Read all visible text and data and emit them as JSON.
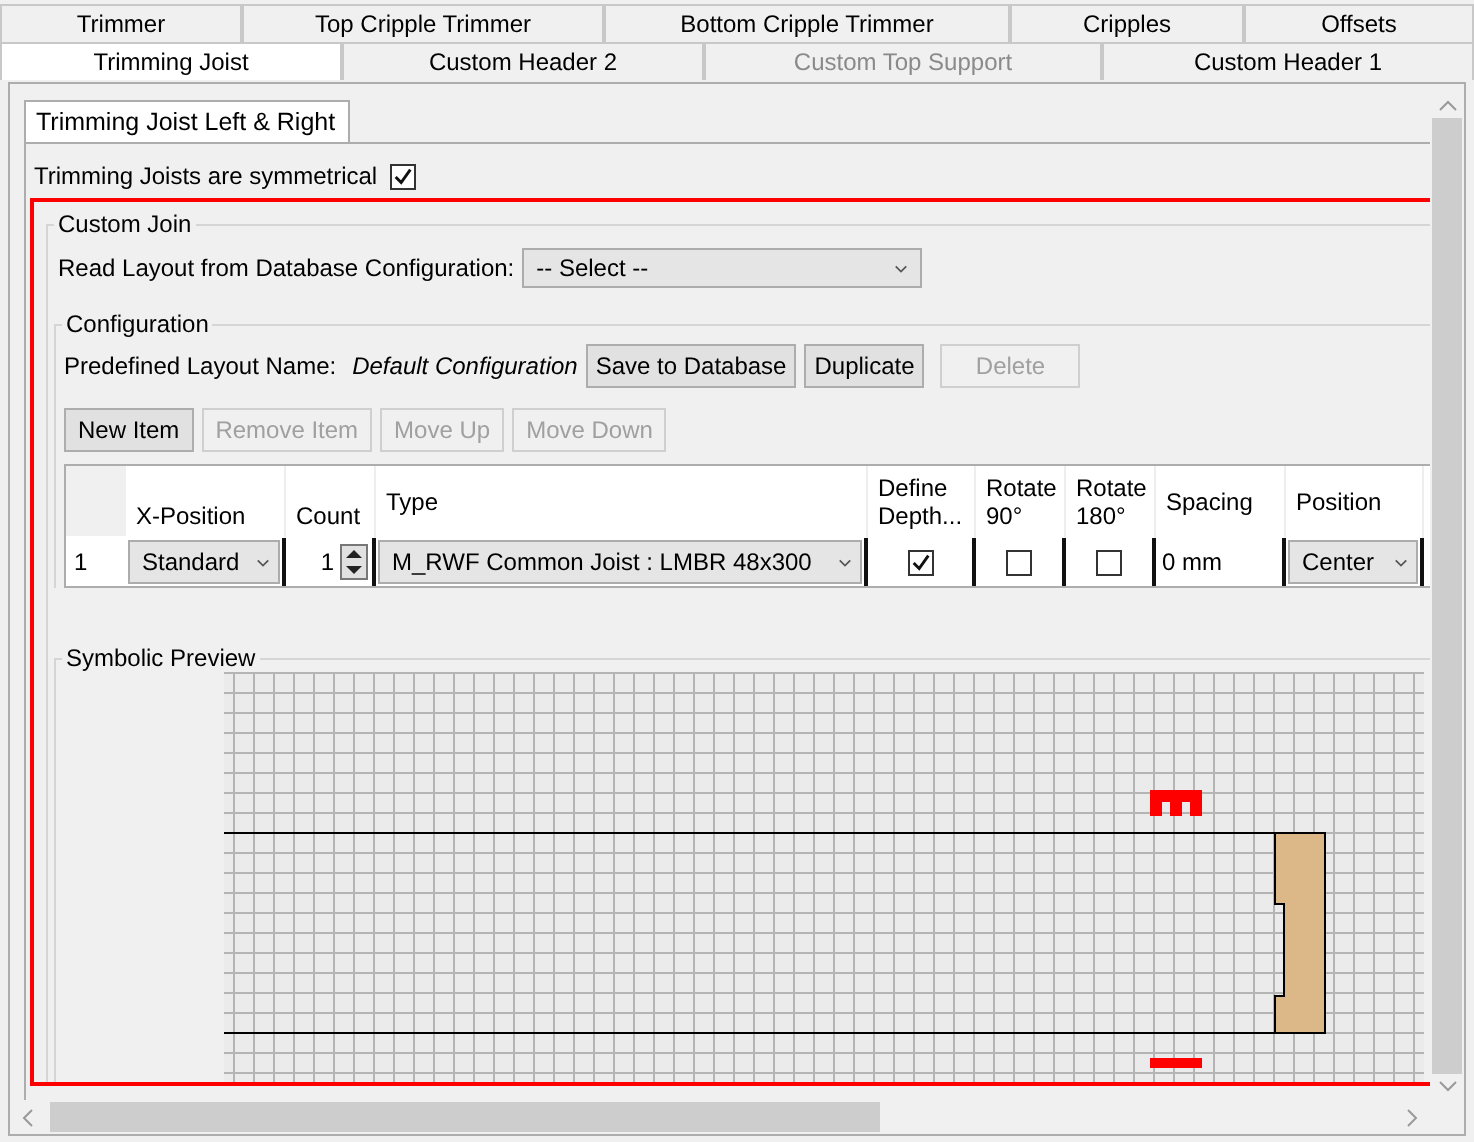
{
  "tab_rows": [
    [
      {
        "label": "Trimmer",
        "selected": false,
        "disabled": false
      },
      {
        "label": "Top Cripple Trimmer",
        "selected": false,
        "disabled": false
      },
      {
        "label": "Bottom Cripple Trimmer",
        "selected": false,
        "disabled": false
      },
      {
        "label": "Cripples",
        "selected": false,
        "disabled": false
      },
      {
        "label": "Offsets",
        "selected": false,
        "disabled": false
      }
    ],
    [
      {
        "label": "Trimming Joist",
        "selected": true,
        "disabled": false
      },
      {
        "label": "Custom Header 2",
        "selected": false,
        "disabled": false
      },
      {
        "label": "Custom Top Support",
        "selected": false,
        "disabled": true
      },
      {
        "label": "Custom Header 1",
        "selected": false,
        "disabled": false
      }
    ]
  ],
  "sub_tabs": [
    {
      "label": "Trimming Joist Left & Right",
      "selected": true
    }
  ],
  "symmetry": {
    "label": "Trimming Joists  are symmetrical",
    "checked": true
  },
  "custom_join": {
    "title": "Custom Join",
    "read_layout_label": "Read Layout from Database Configuration:",
    "read_layout_value": "-- Select --",
    "configuration": {
      "title": "Configuration",
      "predefined_label": "Predefined Layout Name:",
      "predefined_name": "Default Configuration",
      "buttons": [
        {
          "label": "Save to Database",
          "disabled": false
        },
        {
          "label": "Duplicate",
          "disabled": false
        },
        {
          "label": "Delete",
          "disabled": true
        }
      ]
    },
    "item_buttons": [
      {
        "label": "New Item",
        "disabled": false
      },
      {
        "label": "Remove Item",
        "disabled": true
      },
      {
        "label": "Move Up",
        "disabled": true
      },
      {
        "label": "Move Down",
        "disabled": true
      }
    ],
    "table": {
      "columns": [
        "X-Position",
        "Count",
        "Type",
        "Define Depth...",
        "Rotate 90°",
        "Rotate 180°",
        "Spacing",
        "Position"
      ],
      "rows": [
        {
          "index": "1",
          "x_position": "Standard",
          "count": "1",
          "type": "M_RWF Common Joist : LMBR 48x300",
          "define_depth": true,
          "rotate_90": false,
          "rotate_180": false,
          "spacing": "0 mm",
          "position": "Center"
        }
      ]
    }
  },
  "preview": {
    "title": "Symbolic Preview"
  }
}
